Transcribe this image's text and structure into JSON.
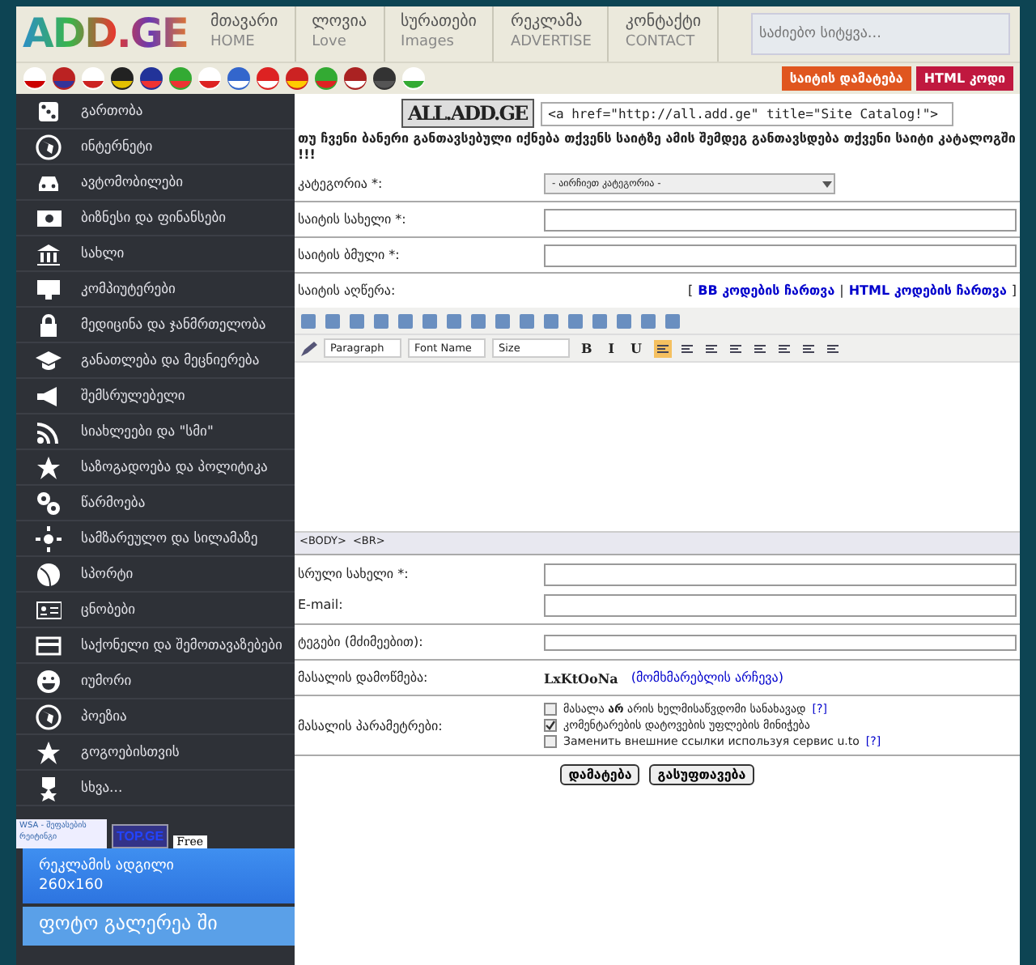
{
  "header": {
    "logo": "ADD.GE",
    "nav": [
      {
        "label": "მთავარი",
        "sub": "HOME"
      },
      {
        "label": "ლოვია",
        "sub": "Love"
      },
      {
        "label": "სურათები",
        "sub": "Images"
      },
      {
        "label": "რეკლამა",
        "sub": "ADVERTISE"
      },
      {
        "label": "კონტაქტი",
        "sub": "CONTACT"
      }
    ],
    "search": {
      "placeholder": "საძიებო სიტყვა..."
    },
    "buttons": [
      {
        "label": "საიტის დამატება",
        "color": "#e0561f"
      },
      {
        "label": "HTML კოდი",
        "color": "#c0183f"
      }
    ]
  },
  "sidebar": {
    "items": [
      {
        "label": "გართობა"
      },
      {
        "label": "ინტერნეტი"
      },
      {
        "label": "ავტომობილები"
      },
      {
        "label": "ბიზნესი და ფინანსები"
      },
      {
        "label": "სახლი"
      },
      {
        "label": "კომპიუტერები"
      },
      {
        "label": "მედიცინა და ჯანმრთელობა"
      },
      {
        "label": "განათლება და მეცნიერება"
      },
      {
        "label": "შემსრულებელი"
      },
      {
        "label": "სიახლეები და \"სმი\""
      },
      {
        "label": "საზოგადოება და პოლიტიკა"
      },
      {
        "label": "წარმოება"
      },
      {
        "label": "სამზარეულო და სილამაზე"
      },
      {
        "label": "სპორტი"
      },
      {
        "label": "ცნობები"
      },
      {
        "label": "საქონელი და შემოთავაზებები"
      },
      {
        "label": "იუმორი"
      },
      {
        "label": "პოეზია"
      },
      {
        "label": "გოგოებისთვის"
      },
      {
        "label": "სხვა..."
      }
    ],
    "badges": {
      "wsa": "WSA - შეფასების რეიტინგი",
      "top": "TOP.GE",
      "free": "Free"
    },
    "ad": {
      "title": "რეკლამის ადგილი",
      "size": "260x160"
    },
    "gallery": "ფოტო გალერეა  ში"
  },
  "form": {
    "logo": "ALL.ADD.GE",
    "code": "<a href=\"http://all.add.ge\" title=\"Site Catalog!\">",
    "notice": "თუ ჩვენი ბანერი განთავსებული იქნება თქვენს საიტზე ამის შემდეგ განთავსდება თქვენი საიტი კატალოგში !!!",
    "category": {
      "label": "კატეგორია *:",
      "value": "- აირჩიეთ კატეგორია -"
    },
    "site_name": {
      "label": "საიტის სახელი *:"
    },
    "site_link": {
      "label": "საიტის ბმული *:"
    },
    "description": {
      "label": "საიტის აღწერა:",
      "links": [
        "BB კოდების ჩართვა",
        "HTML კოდების ჩართვა"
      ],
      "separators": [
        "[",
        "|",
        "]"
      ]
    },
    "editor": {
      "selects": [
        "Paragraph",
        "Font Name",
        "Size"
      ],
      "format_buttons": [
        "B",
        "I",
        "U"
      ],
      "path": [
        "<BODY>",
        "<BR>"
      ]
    },
    "full_name": {
      "label": "სრული სახელი *:"
    },
    "email": {
      "label": "E-mail:"
    },
    "tags": {
      "label": "ტეგები (მძიმეებით):"
    },
    "captcha": {
      "label": "მასალის დამოწმება:",
      "code": "LxKtOoNa",
      "link": "(მომხმარებლის არჩევა)"
    },
    "options": {
      "label": "მასალის პარამეტრები:",
      "items": [
        {
          "text": "მასალა **არ** არის ხელმისაწვდომი სანახავად",
          "help": "[?]",
          "checked": false
        },
        {
          "text": "კომენტარების დატოვების უფლების მინიჭება",
          "checked": true
        },
        {
          "text": "Заменить внешние ссылки используя сервис u.to",
          "help": "[?]",
          "checked": false
        }
      ]
    },
    "buttons": [
      "დამატება",
      "გასუფთავება"
    ]
  }
}
